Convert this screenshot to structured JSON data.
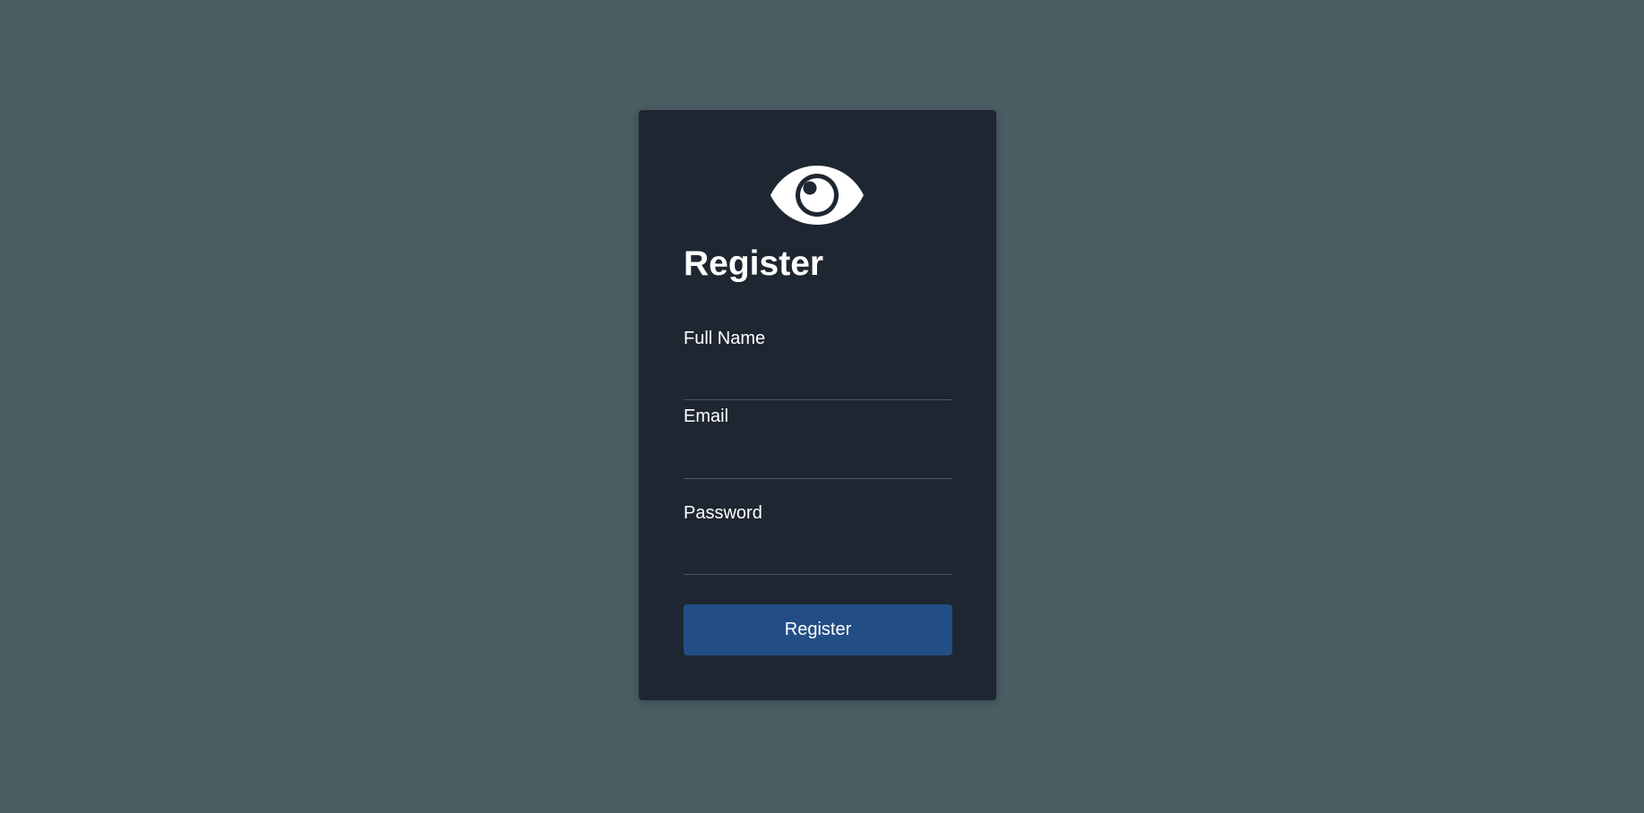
{
  "page": {
    "background_color": "#4a5d63"
  },
  "card": {
    "background_color": "#1e2631",
    "logo_icon": "eye-icon",
    "title": "Register"
  },
  "form": {
    "full_name": {
      "label": "Full Name",
      "value": ""
    },
    "email": {
      "label": "Email",
      "value": ""
    },
    "password": {
      "label": "Password",
      "value": ""
    },
    "submit_label": "Register",
    "submit_color": "#234e85"
  }
}
